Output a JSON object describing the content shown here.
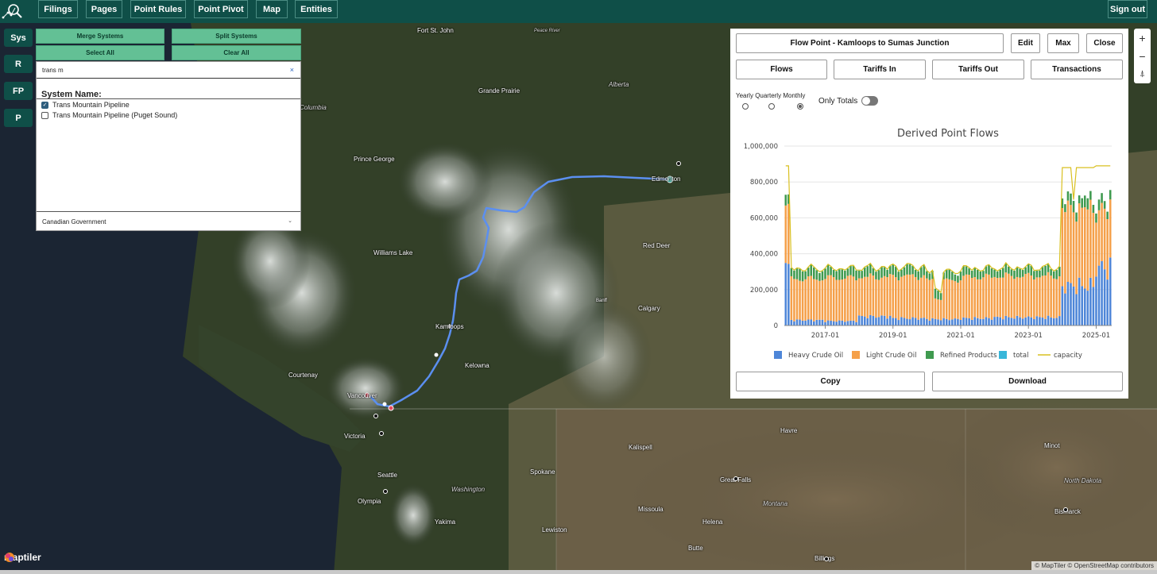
{
  "nav": {
    "items": [
      "Filings",
      "Pages",
      "Point Rules",
      "Point Pivot",
      "Map",
      "Entities"
    ],
    "sign_out": "Sign out"
  },
  "side_buttons": [
    "Sys",
    "R",
    "FP",
    "P"
  ],
  "systems_panel": {
    "merge_label": "Merge Systems",
    "split_label": "Split Systems",
    "select_all_label": "Select All",
    "clear_all_label": "Clear All",
    "search_value": "trans m",
    "search_clear": "×",
    "system_name_label": "System Name:",
    "systems": [
      {
        "name": "Trans Mountain Pipeline",
        "checked": true
      },
      {
        "name": "Trans Mountain Pipeline (Puget Sound)",
        "checked": false
      }
    ],
    "dropdown_value": "Canadian Government"
  },
  "flow_panel": {
    "title": "Flow Point - Kamloops to Sumas Junction",
    "edit_label": "Edit",
    "max_label": "Max",
    "close_label": "Close",
    "tabs": [
      "Flows",
      "Tariffs In",
      "Tariffs Out",
      "Transactions"
    ],
    "periods": [
      "Yearly",
      "Quarterly",
      "Monthly"
    ],
    "selected_period": "Monthly",
    "only_totals_label": "Only Totals",
    "only_totals_on": false,
    "copy_label": "Copy",
    "download_label": "Download"
  },
  "chart_data": {
    "type": "bar",
    "stacked": true,
    "title": "Derived Point Flows",
    "xlabel": "",
    "ylabel": "",
    "ylim": [
      0,
      1000000
    ],
    "yticks": [
      "0",
      "200,000",
      "400,000",
      "600,000",
      "800,000",
      "1,000,000"
    ],
    "xticks": [
      "2017-01",
      "2019-01",
      "2021-01",
      "2023-01",
      "2025-01"
    ],
    "x_start": "2015-11",
    "x_end": "2025-06",
    "grid": true,
    "legend_position": "bottom",
    "colors": {
      "Heavy Crude Oil": "#4e86d8",
      "Light Crude Oil": "#f5a04a",
      "Refined Products": "#3f9a4f",
      "total": "#38b6d9",
      "capacity": "#d9c020"
    },
    "legend": [
      "Heavy Crude Oil",
      "Light Crude Oil",
      "Refined Products",
      "total",
      "capacity"
    ],
    "yearly_profile": [
      {
        "period": "2016",
        "heavy": 30000,
        "light": 230000,
        "refined": 55000,
        "capacity": 300000
      },
      {
        "period": "2017",
        "heavy": 25000,
        "light": 240000,
        "refined": 50000,
        "capacity": 300000
      },
      {
        "period": "2018",
        "heavy": 50000,
        "light": 220000,
        "refined": 50000,
        "capacity": 300000
      },
      {
        "period": "2019",
        "heavy": 40000,
        "light": 235000,
        "refined": 50000,
        "capacity": 300000
      },
      {
        "period": "2020",
        "heavy": 35000,
        "light": 215000,
        "refined": 45000,
        "capacity": 290000
      },
      {
        "period": "2021",
        "heavy": 40000,
        "light": 230000,
        "refined": 45000,
        "capacity": 300000
      },
      {
        "period": "2022",
        "heavy": 45000,
        "light": 230000,
        "refined": 45000,
        "capacity": 300000
      },
      {
        "period": "2023",
        "heavy": 45000,
        "light": 230000,
        "refined": 45000,
        "capacity": 300000
      },
      {
        "period": "2024",
        "heavy": 220000,
        "light": 430000,
        "refined": 55000,
        "capacity": 880000
      },
      {
        "period": "2025",
        "heavy": 320000,
        "light": 320000,
        "refined": 50000,
        "capacity": 890000
      }
    ]
  },
  "map": {
    "cities": [
      {
        "name": "Fort St. John"
      },
      {
        "name": "Peace River"
      },
      {
        "name": "Alberta"
      },
      {
        "name": "Grande Prairie"
      },
      {
        "name": "Columbia"
      },
      {
        "name": "Prince George"
      },
      {
        "name": "Edmonton"
      },
      {
        "name": "Red Deer"
      },
      {
        "name": "Williams Lake"
      },
      {
        "name": "Calgary"
      },
      {
        "name": "Banff"
      },
      {
        "name": "Kamloops"
      },
      {
        "name": "Kelowna"
      },
      {
        "name": "Courtenay"
      },
      {
        "name": "Vancouver"
      },
      {
        "name": "Victoria"
      },
      {
        "name": "Seattle"
      },
      {
        "name": "Spokane"
      },
      {
        "name": "Washington"
      },
      {
        "name": "Olympia"
      },
      {
        "name": "Yakima"
      },
      {
        "name": "Lewiston"
      },
      {
        "name": "Missoula"
      },
      {
        "name": "Kalispell"
      },
      {
        "name": "Great Falls"
      },
      {
        "name": "Montana"
      },
      {
        "name": "Helena"
      },
      {
        "name": "Havre"
      },
      {
        "name": "Butte"
      },
      {
        "name": "Billings"
      },
      {
        "name": "Minot"
      },
      {
        "name": "North Dakota"
      },
      {
        "name": "Bismarck"
      }
    ],
    "attribution": "© MapTiler © OpenStreetMap contributors",
    "brand": "maptiler"
  }
}
